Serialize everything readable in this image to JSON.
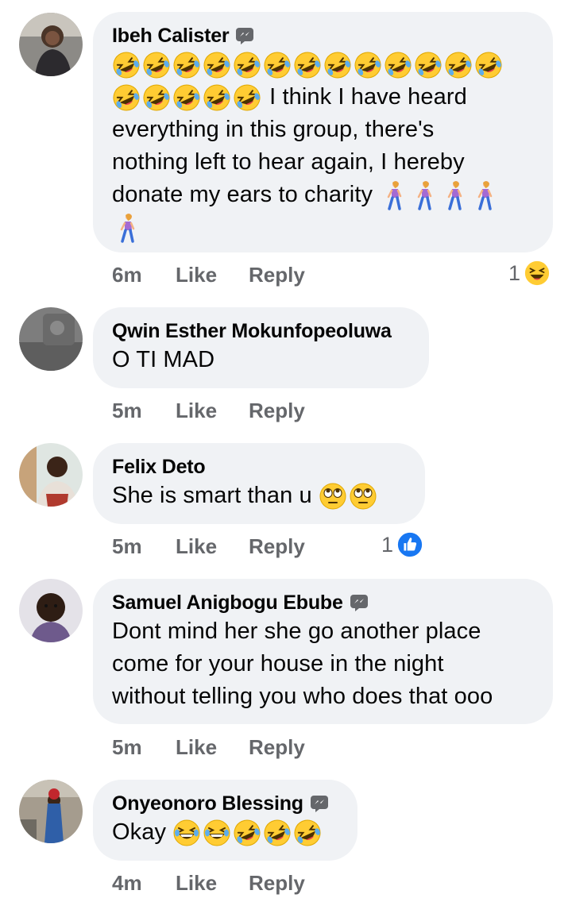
{
  "comments": [
    {
      "name": "Ibeh Calister",
      "text_line_1": "I think I have heard",
      "text_line_2": "everything in this group, there's",
      "text_line_3": "nothing left to hear again, I hereby",
      "text_line_4": "donate my ears to charity",
      "time": "6m",
      "like_label": "Like",
      "reply_label": "Reply",
      "reaction_count": "1",
      "reaction_icon": "laughing-react-icon"
    },
    {
      "name": "Qwin Esther Mokunfopeoluwa",
      "text": "O TI MAD",
      "time": "5m",
      "like_label": "Like",
      "reply_label": "Reply"
    },
    {
      "name": "Felix Deto",
      "text": "She is smart than u",
      "time": "5m",
      "like_label": "Like",
      "reply_label": "Reply",
      "reaction_count": "1",
      "reaction_icon": "like-react-icon"
    },
    {
      "name": "Samuel Anigbogu Ebube",
      "text_line_1": "Dont mind her she go another place",
      "text_line_2": "come for your house in the night",
      "text_line_3": "without telling you who does that ooo",
      "time": "5m",
      "like_label": "Like",
      "reply_label": "Reply"
    },
    {
      "name": "Onyeonoro Blessing",
      "text": "Okay",
      "time": "4m",
      "like_label": "Like",
      "reply_label": "Reply"
    }
  ],
  "colors": {
    "bubble": "#f0f2f5",
    "meta_text": "#65676b",
    "like_blue": "#1877f2",
    "emoji_yellow": "#ffcc33"
  },
  "icons": [
    "rolling-laughing-emoji",
    "walking-woman-emoji",
    "eye-roll-emoji",
    "grinning-squint-emoji",
    "messenger-badge-icon"
  ]
}
